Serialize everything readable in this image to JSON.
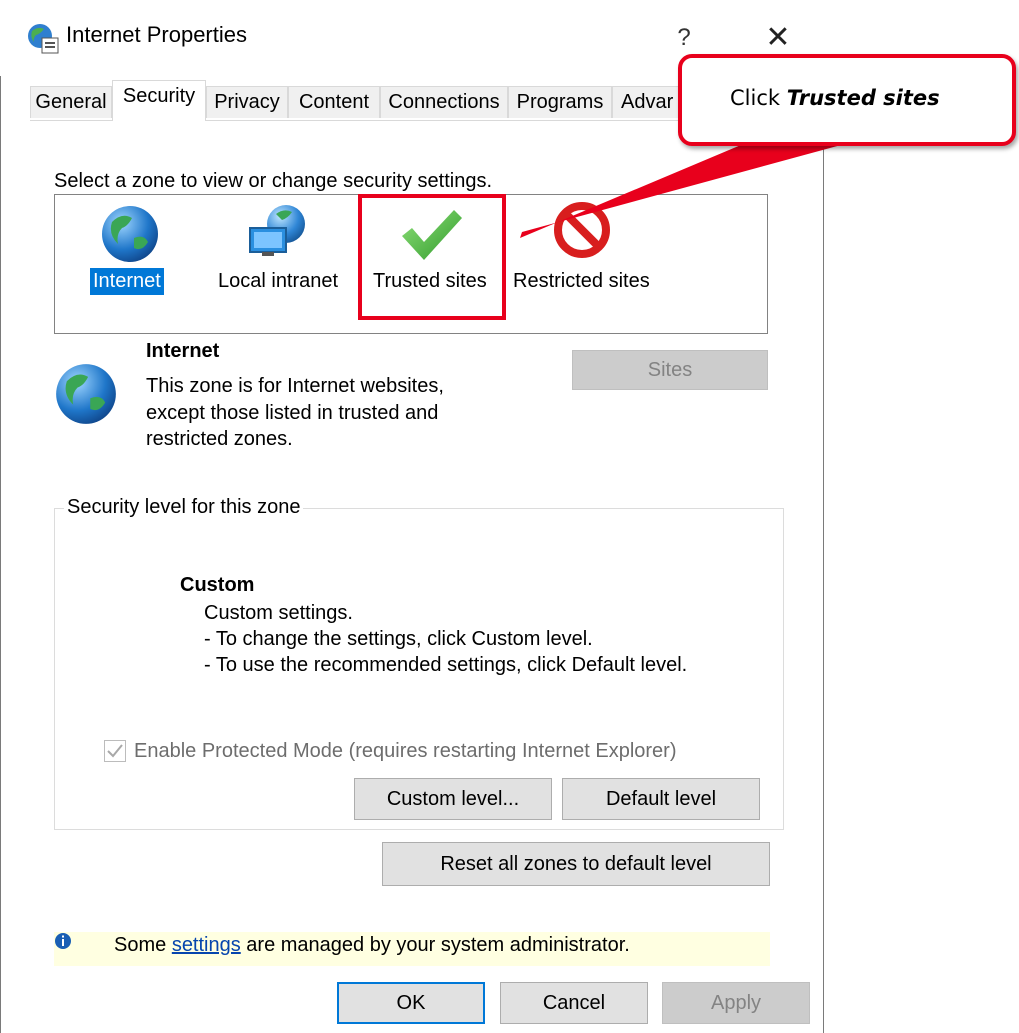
{
  "window": {
    "title": "Internet Properties",
    "help_glyph": "?",
    "close_glyph": "✕"
  },
  "tabs": [
    {
      "label": "General"
    },
    {
      "label": "Security"
    },
    {
      "label": "Privacy"
    },
    {
      "label": "Content"
    },
    {
      "label": "Connections"
    },
    {
      "label": "Programs"
    },
    {
      "label": "Advar"
    }
  ],
  "security": {
    "zone_prompt": "Select a zone to view or change security settings.",
    "zones": [
      {
        "label": "Internet",
        "icon": "globe-icon",
        "selected": true
      },
      {
        "label": "Local intranet",
        "icon": "intranet-icon",
        "selected": false
      },
      {
        "label": "Trusted sites",
        "icon": "checkmark-icon",
        "selected": false
      },
      {
        "label": "Restricted sites",
        "icon": "restricted-icon",
        "selected": false
      }
    ],
    "zone_info": {
      "title": "Internet",
      "desc_line1": "This zone is for Internet websites,",
      "desc_line2": "except those listed in trusted and",
      "desc_line3": "restricted zones."
    },
    "sites_button": "Sites",
    "level_group": {
      "legend": "Security level for this zone",
      "level_title": "Custom",
      "line1": "Custom settings.",
      "line2": "- To change the settings, click Custom level.",
      "line3": "- To use the recommended settings, click Default level."
    },
    "protected_mode_label": "Enable Protected Mode (requires restarting Internet Explorer)",
    "protected_mode_checked": true,
    "custom_level_button": "Custom level...",
    "default_level_button": "Default level",
    "reset_button": "Reset all zones to default level",
    "admin_notice": {
      "prefix": "Some ",
      "link": "settings",
      "suffix": " are managed by your system administrator."
    }
  },
  "footer": {
    "ok": "OK",
    "cancel": "Cancel",
    "apply": "Apply"
  },
  "annotation": {
    "callout_prefix": "Click ",
    "callout_emphasis": "Trusted sites"
  },
  "colors": {
    "selection": "#0078d7",
    "annotation_red": "#e8001c",
    "info_bar": "#ffffe1"
  }
}
